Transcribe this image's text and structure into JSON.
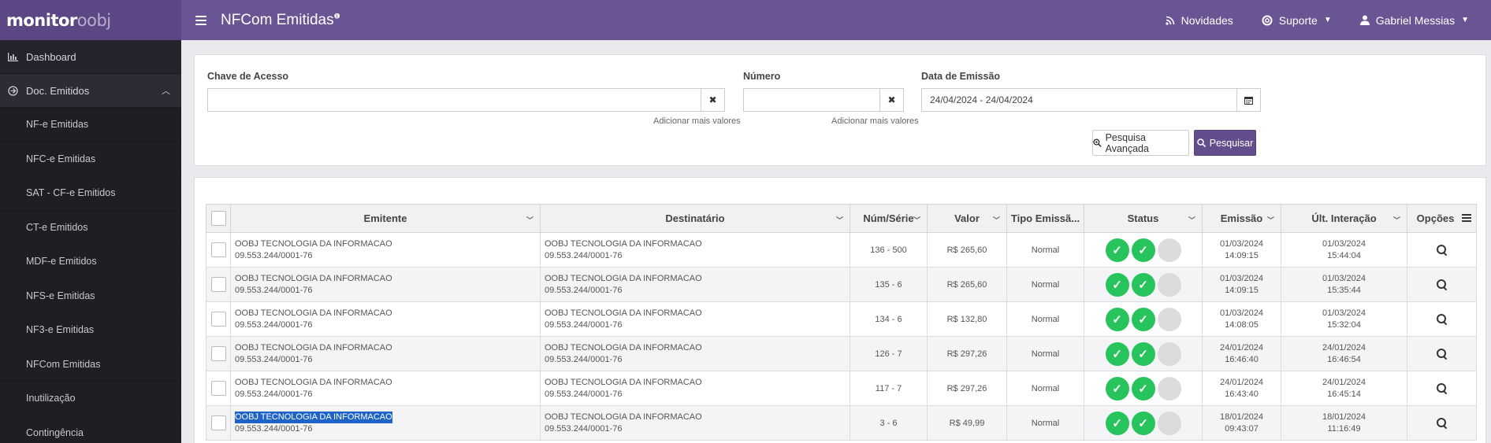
{
  "topbar": {
    "logo_bold": "monitor",
    "logo_light": "oobj",
    "title": "NFCom Emitidas",
    "title_sup": "❶",
    "novidades": "Novidades",
    "suporte": "Suporte",
    "user": "Gabriel Messias"
  },
  "sidebar": {
    "dashboard": "Dashboard",
    "doc_emitidos": "Doc. Emitidos",
    "items": [
      {
        "label": "NF-e Emitidas"
      },
      {
        "label": "NFC-e Emitidas"
      },
      {
        "label": "SAT - CF-e Emitidos"
      },
      {
        "label": "CT-e Emitidos"
      },
      {
        "label": "MDF-e Emitidos"
      },
      {
        "label": "NFS-e Emitidas"
      },
      {
        "label": "NF3-e Emitidas"
      },
      {
        "label": "NFCom Emitidas"
      },
      {
        "label": "Inutilização"
      },
      {
        "label": "Contingência"
      }
    ]
  },
  "filters": {
    "chave_label": "Chave de Acesso",
    "chave_value": "",
    "chave_hint": "Adicionar mais valores",
    "numero_label": "Número",
    "numero_value": "",
    "numero_hint": "Adicionar mais valores",
    "data_label": "Data de Emissão",
    "data_value": "24/04/2024 - 24/04/2024",
    "btn_advanced": "Pesquisa Avançada",
    "btn_search": "Pesquisar"
  },
  "table": {
    "headers": {
      "emitente": "Emitente",
      "destinatario": "Destinatário",
      "num_serie": "Núm/Série",
      "valor": "Valor",
      "tipo": "Tipo Emissã...",
      "status": "Status",
      "emissao": "Emissão",
      "ult_interacao": "Últ. Interação",
      "opcoes": "Opções"
    },
    "rows": [
      {
        "emitente": "OOBJ TECNOLOGIA DA INFORMACAO",
        "emitente_cnpj": "09.553.244/0001-76",
        "destinatario": "OOBJ TECNOLOGIA DA INFORMACAO",
        "destinatario_cnpj": "09.553.244/0001-76",
        "num_serie": "136 - 500",
        "valor": "R$ 265,60",
        "tipo": "Normal",
        "emissao_data": "01/03/2024",
        "emissao_hora": "14:09:15",
        "ult_data": "01/03/2024",
        "ult_hora": "15:44:04"
      },
      {
        "emitente": "OOBJ TECNOLOGIA DA INFORMACAO",
        "emitente_cnpj": "09.553.244/0001-76",
        "destinatario": "OOBJ TECNOLOGIA DA INFORMACAO",
        "destinatario_cnpj": "09.553.244/0001-76",
        "num_serie": "135 - 6",
        "valor": "R$ 265,60",
        "tipo": "Normal",
        "emissao_data": "01/03/2024",
        "emissao_hora": "14:09:15",
        "ult_data": "01/03/2024",
        "ult_hora": "15:35:44"
      },
      {
        "emitente": "OOBJ TECNOLOGIA DA INFORMACAO",
        "emitente_cnpj": "09.553.244/0001-76",
        "destinatario": "OOBJ TECNOLOGIA DA INFORMACAO",
        "destinatario_cnpj": "09.553.244/0001-76",
        "num_serie": "134 - 6",
        "valor": "R$ 132,80",
        "tipo": "Normal",
        "emissao_data": "01/03/2024",
        "emissao_hora": "14:08:05",
        "ult_data": "01/03/2024",
        "ult_hora": "15:32:04"
      },
      {
        "emitente": "OOBJ TECNOLOGIA DA INFORMACAO",
        "emitente_cnpj": "09.553.244/0001-76",
        "destinatario": "OOBJ TECNOLOGIA DA INFORMACAO",
        "destinatario_cnpj": "09.553.244/0001-76",
        "num_serie": "126 - 7",
        "valor": "R$ 297,26",
        "tipo": "Normal",
        "emissao_data": "24/01/2024",
        "emissao_hora": "16:46:40",
        "ult_data": "24/01/2024",
        "ult_hora": "16:46:54"
      },
      {
        "emitente": "OOBJ TECNOLOGIA DA INFORMACAO",
        "emitente_cnpj": "09.553.244/0001-76",
        "destinatario": "OOBJ TECNOLOGIA DA INFORMACAO",
        "destinatario_cnpj": "09.553.244/0001-76",
        "num_serie": "117 - 7",
        "valor": "R$ 297,26",
        "tipo": "Normal",
        "emissao_data": "24/01/2024",
        "emissao_hora": "16:43:40",
        "ult_data": "24/01/2024",
        "ult_hora": "16:45:14"
      },
      {
        "emitente": "OOBJ TECNOLOGIA DA INFORMACAO",
        "emitente_cnpj": "09.553.244/0001-76",
        "destinatario": "OOBJ TECNOLOGIA DA INFORMACAO",
        "destinatario_cnpj": "09.553.244/0001-76",
        "num_serie": "3 - 6",
        "valor": "R$ 49,99",
        "tipo": "Normal",
        "emissao_data": "18/01/2024",
        "emissao_hora": "09:43:07",
        "ult_data": "18/01/2024",
        "ult_hora": "11:16:49"
      }
    ]
  },
  "colors": {
    "topbar": "#6b5494",
    "sidebar": "#25232b",
    "status_ok": "#27c45d",
    "status_off": "#dcdcdc",
    "search_button": "#634d8c"
  }
}
